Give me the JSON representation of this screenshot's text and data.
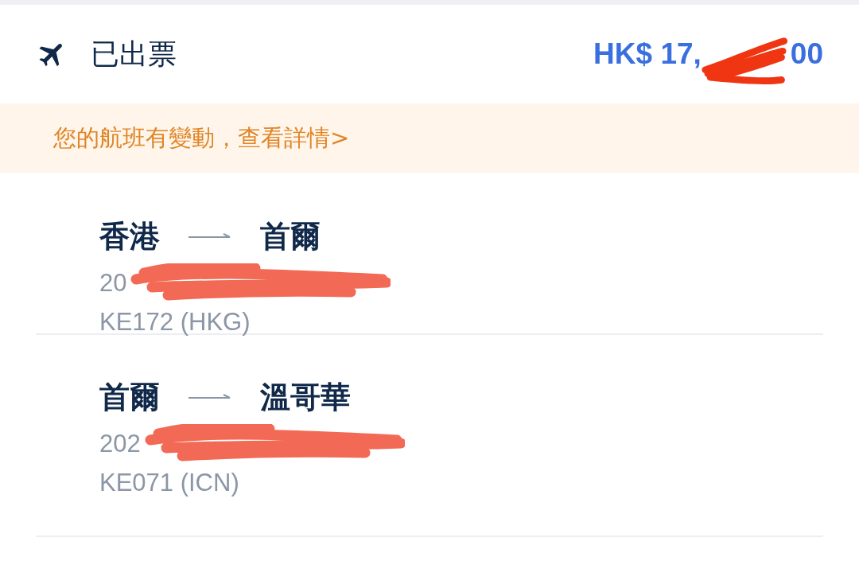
{
  "header": {
    "status": "已出票",
    "price_start": "HK$ 17,",
    "price_end": "00",
    "price_redacted": true
  },
  "notice": {
    "text": "您的航班有變動，查看詳情>"
  },
  "segments": [
    {
      "from": "香港",
      "to": "首爾",
      "date": "20",
      "date_redacted": true,
      "flight": "KE172 (HKG)"
    },
    {
      "from": "首爾",
      "to": "溫哥華",
      "date": "202",
      "date_redacted": true,
      "flight": "KE071 (ICN)"
    }
  ]
}
